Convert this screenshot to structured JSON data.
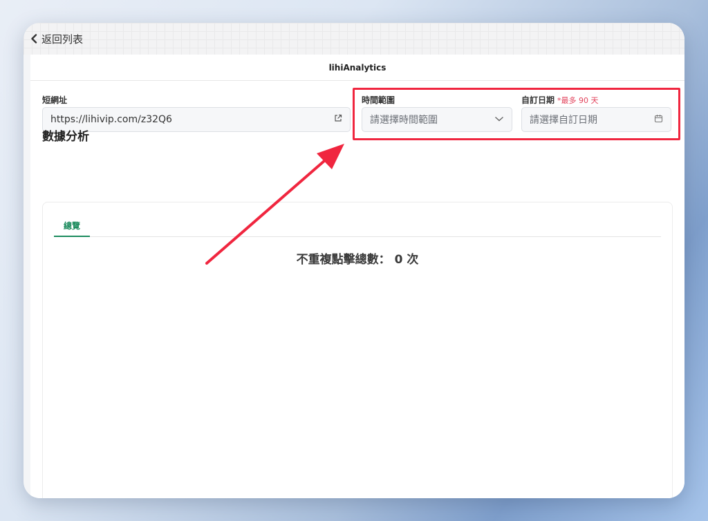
{
  "nav": {
    "back_label": "返回列表"
  },
  "header": {
    "title": "lihiAnalytics"
  },
  "form": {
    "short_url_label": "短網址",
    "short_url_value": "https://lihivip.com/z32Q6",
    "time_range_label": "時間範圍",
    "time_range_placeholder": "請選擇時間範圍",
    "custom_date_label": "自訂日期",
    "custom_date_note": "*最多 90 天",
    "custom_date_placeholder": "請選擇自訂日期"
  },
  "analytics": {
    "section_title": "數據分析",
    "tabs": [
      {
        "label": "總覽",
        "active": true
      }
    ],
    "unique_clicks_text": "不重複點擊總數： 0 次"
  },
  "colors": {
    "accent_green": "#1a8a5c",
    "highlight_red": "#f0263f",
    "note_red": "#e2425b"
  },
  "icons": [
    "chevron-left-icon",
    "external-link-icon",
    "chevron-down-icon",
    "calendar-icon"
  ]
}
